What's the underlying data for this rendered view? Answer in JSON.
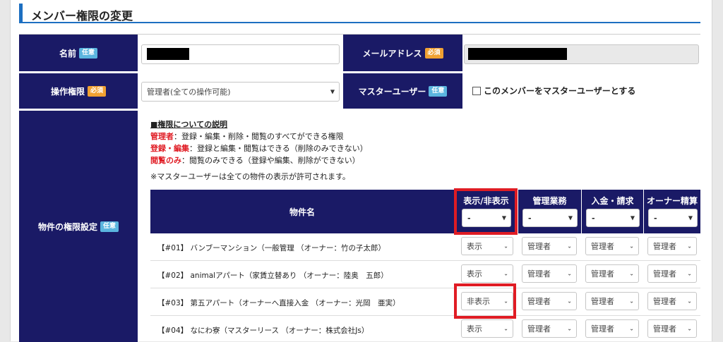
{
  "page_title": "メンバー権限の変更",
  "badges": {
    "optional": "任意",
    "required": "必須"
  },
  "fields": {
    "name_label": "名前",
    "email_label": "メールアドレス",
    "operation_label": "操作権限",
    "operation_value": "管理者(全ての操作可能)",
    "master_label": "マスターユーザー",
    "master_checkbox_label": "このメンバーをマスターユーザーとする",
    "property_label": "物件の権限設定"
  },
  "explanation": {
    "heading": "■権限についての説明",
    "lines": [
      {
        "role": "管理者",
        "desc": "：登録・編集・削除・閲覧のすべてができる権限"
      },
      {
        "role": "登録・編集",
        "desc": "：登録と編集・閲覧はできる（削除のみできない）"
      },
      {
        "role": "閲覧のみ",
        "desc": "：閲覧のみできる（登録や編集、削除ができない）"
      }
    ],
    "note": "※マスターユーザーは全ての物件の表示が許可されます。"
  },
  "table": {
    "headers": [
      "物件名",
      "表示/非表示",
      "管理業務",
      "入金・請求",
      "オーナー精算"
    ],
    "header_selects": [
      "-",
      "-",
      "-",
      "-"
    ],
    "rows": [
      {
        "name": "【#01】 バンブーマンション（一般管理 （オーナー：竹の子太郎）",
        "display": "表示",
        "mgmt": "管理者",
        "payment": "管理者",
        "owner": "管理者"
      },
      {
        "name": "【#02】 animalアパート（家賃立替あり （オーナー：陸奥　五郎）",
        "display": "表示",
        "mgmt": "管理者",
        "payment": "管理者",
        "owner": "管理者"
      },
      {
        "name": "【#03】 第五アパート（オーナーへ直接入金 （オーナー：光岡　亜実）",
        "display": "非表示",
        "mgmt": "管理者",
        "payment": "管理者",
        "owner": "管理者"
      },
      {
        "name": "【#04】 なにわ寮（マスターリース （オーナー：株式会社Js）",
        "display": "表示",
        "mgmt": "管理者",
        "payment": "管理者",
        "owner": "管理者"
      }
    ]
  },
  "colors": {
    "label_bg": "#1a1a66",
    "accent": "#1d6fc1",
    "highlight": "#e01c24",
    "optional_badge": "#5bb5df",
    "required_badge": "#f0a132"
  },
  "icons": {
    "select_arrow": "chevron-down-icon"
  }
}
